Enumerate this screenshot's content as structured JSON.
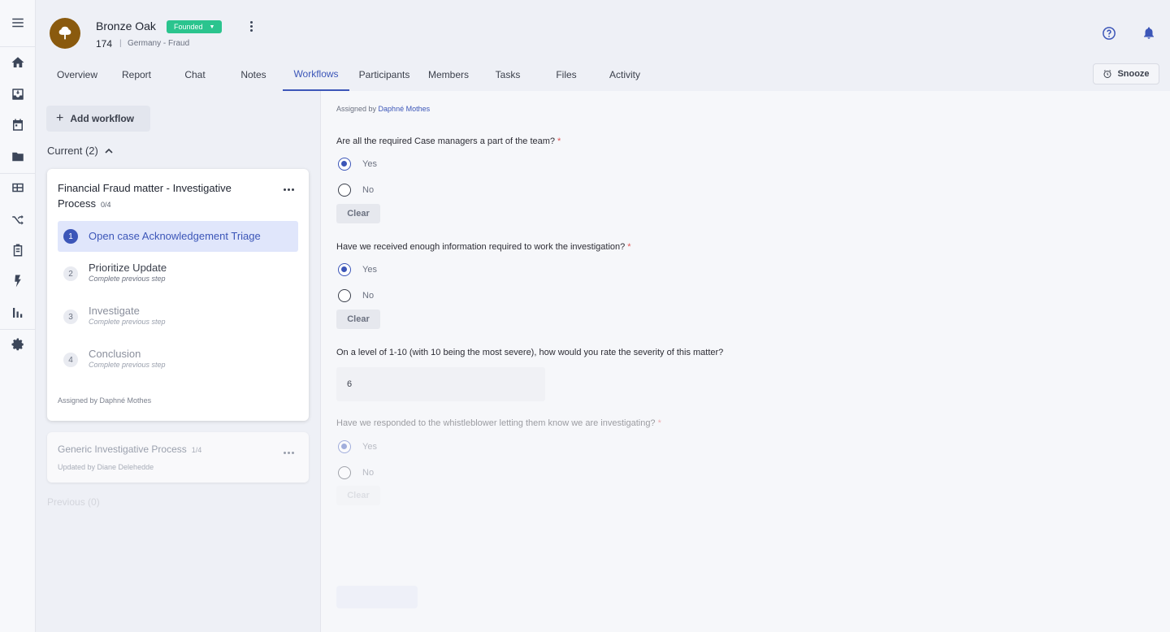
{
  "rail": {
    "icons": [
      "menu-icon",
      "home-icon",
      "inbox-icon",
      "calendar-icon",
      "folder-icon",
      "table-icon",
      "shuffle-icon",
      "clipboard-icon",
      "bolt-icon",
      "bar-chart-icon",
      "gear-icon"
    ]
  },
  "header": {
    "case_name": "Bronze Oak",
    "status_badge": "Founded",
    "case_id": "174",
    "separator": "|",
    "case_meta": "Germany - Fraud",
    "snooze_label": "Snooze"
  },
  "tabs": [
    "Overview",
    "Report",
    "Chat",
    "Notes",
    "Workflows",
    "Participants",
    "Members",
    "Tasks",
    "Files",
    "Activity"
  ],
  "active_tab": "Workflows",
  "workflows": {
    "add_label": "Add workflow",
    "current_label": "Current (2)",
    "card": {
      "title": "Financial Fraud matter - Investigative Process",
      "count": "0/4",
      "steps": [
        {
          "num": "1",
          "label": "Open case Acknowledgement Triage",
          "sub": ""
        },
        {
          "num": "2",
          "label": "Prioritize Update",
          "sub": "Complete previous step"
        },
        {
          "num": "3",
          "label": "Investigate",
          "sub": "Complete previous step"
        },
        {
          "num": "4",
          "label": "Conclusion",
          "sub": "Complete previous step"
        }
      ],
      "assigned": "Assigned by Daphné Mothes"
    },
    "card2": {
      "title": "Generic Investigative Process",
      "count": "1/4",
      "updated": "Updated by Diane Delehedde"
    },
    "previous_label": "Previous (0)"
  },
  "form": {
    "assigned_prefix": "Assigned by",
    "assigned_name": "Daphné Mothes",
    "q1": "Are all the required Case managers a part of the team?",
    "q2": "Have we received enough information required to work the investigation?",
    "q3": "On a level of 1-10 (with 10 being the most severe), how would you rate the severity of this matter?",
    "q4": "Have we responded to the whistleblower letting them know we are investigating?",
    "required_mark": "*",
    "yes": "Yes",
    "no": "No",
    "clear": "Clear",
    "severity_value": "6"
  },
  "colors": {
    "accent": "#3c56b8",
    "badge": "#2bc48e",
    "avatar": "#8a5a0e",
    "required": "#e25555"
  }
}
